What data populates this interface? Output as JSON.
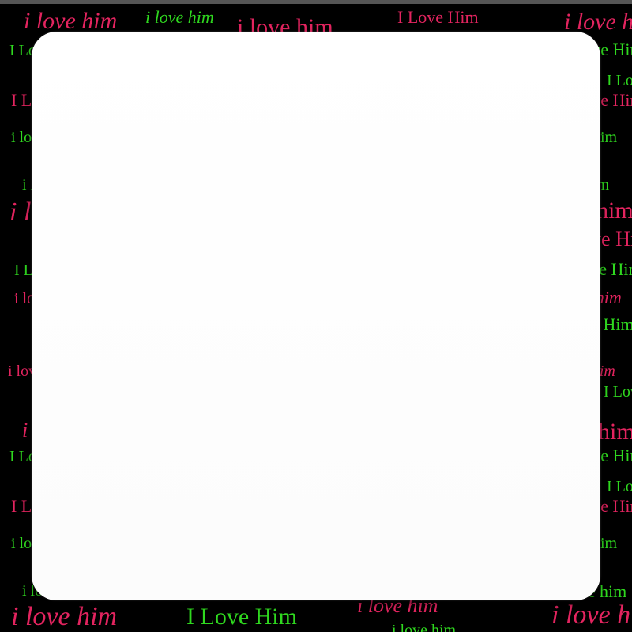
{
  "wallpaper": {
    "colors": {
      "background": "#000000",
      "pink": "#e3245f",
      "green": "#2fd81f",
      "panel": "#ffffff"
    },
    "phrases": {
      "lower_italic": "i love him",
      "title_case": "I Love Him"
    }
  },
  "panel": {
    "label": ""
  }
}
